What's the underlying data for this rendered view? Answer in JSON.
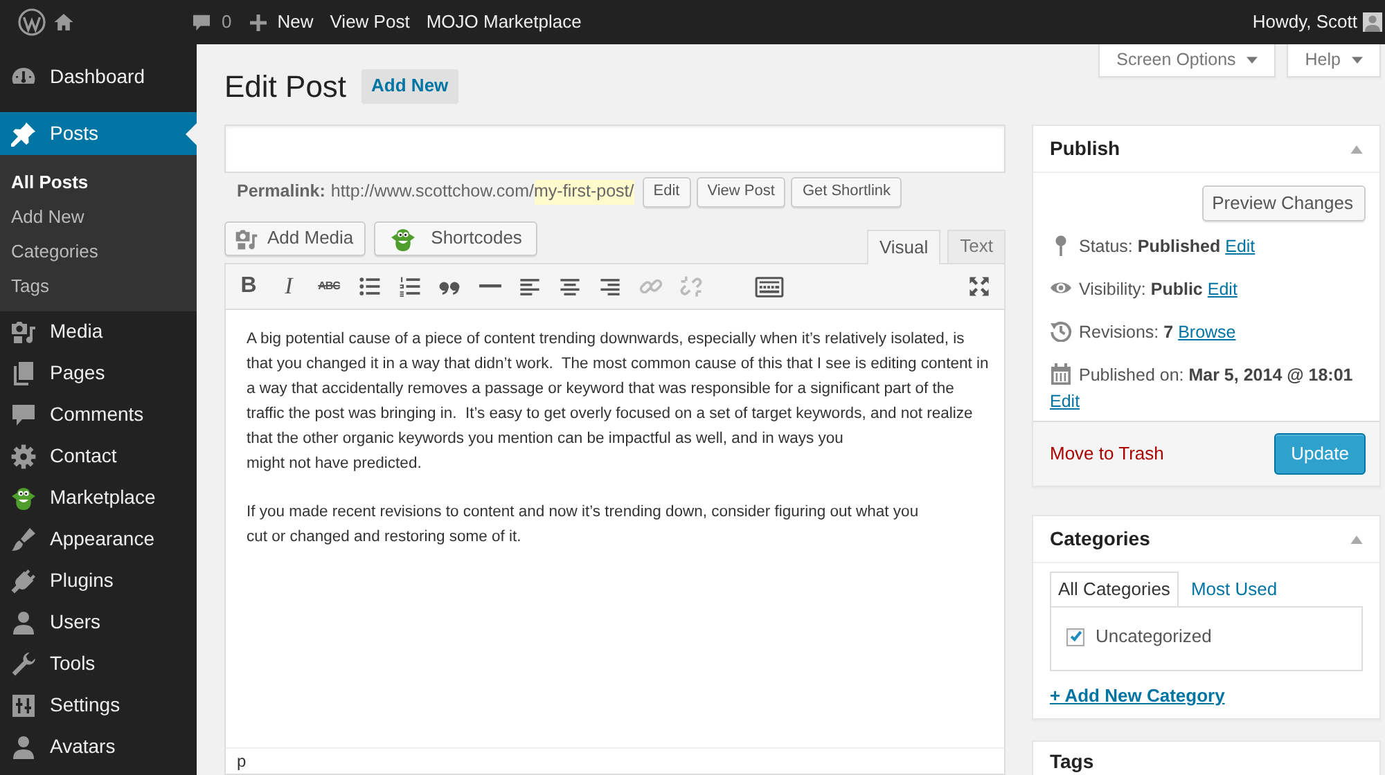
{
  "admin_bar": {
    "items": [
      {
        "kind": "comments",
        "label": "0"
      },
      {
        "kind": "new",
        "label": "New"
      },
      {
        "kind": "link",
        "label": "View Post"
      },
      {
        "kind": "link",
        "label": "MOJO Marketplace"
      }
    ],
    "greeting": "Howdy, Scott"
  },
  "sidebar": {
    "items": [
      {
        "label": "Dashboard",
        "selected": false
      },
      {
        "label": "Posts",
        "selected": true,
        "children": [
          {
            "label": "All Posts",
            "selected": true
          },
          {
            "label": "Add New",
            "selected": false
          },
          {
            "label": "Categories",
            "selected": false
          },
          {
            "label": "Tags",
            "selected": false
          }
        ]
      },
      {
        "label": "Media",
        "selected": false
      },
      {
        "label": "Pages",
        "selected": false
      },
      {
        "label": "Comments",
        "selected": false
      },
      {
        "label": "Contact",
        "selected": false
      },
      {
        "label": "Marketplace",
        "selected": false
      },
      {
        "label": "Appearance",
        "selected": false
      },
      {
        "label": "Plugins",
        "selected": false
      },
      {
        "label": "Users",
        "selected": false
      },
      {
        "label": "Tools",
        "selected": false
      },
      {
        "label": "Settings",
        "selected": false
      },
      {
        "label": "Avatars",
        "selected": false
      }
    ]
  },
  "screen_meta": {
    "tabs": [
      "Screen Options",
      "Help"
    ]
  },
  "page": {
    "title": "Edit Post",
    "add_new": "Add New"
  },
  "permalink": {
    "label": "Permalink:",
    "base": "http://www.scottchow.com/",
    "slug": "my-first-post/",
    "buttons": [
      "Edit",
      "View Post",
      "Get Shortlink"
    ]
  },
  "media_buttons": [
    {
      "kind": "media",
      "label": "Add Media"
    },
    {
      "kind": "shortcodes",
      "label": "Shortcodes"
    }
  ],
  "editor_tabs": [
    {
      "label": "Visual",
      "selected": true
    },
    {
      "label": "Text",
      "selected": false
    }
  ],
  "toolbar": [
    {
      "kind": "bold",
      "glyph": "B",
      "disabled": false
    },
    {
      "kind": "italic",
      "glyph": "I",
      "disabled": false
    },
    {
      "kind": "strikethrough",
      "glyph": "ABC",
      "disabled": false
    },
    {
      "kind": "bullet-list",
      "disabled": false
    },
    {
      "kind": "numbered-list",
      "disabled": false
    },
    {
      "kind": "blockquote",
      "disabled": false
    },
    {
      "kind": "horizontal-rule",
      "disabled": false
    },
    {
      "kind": "align-left",
      "disabled": false
    },
    {
      "kind": "align-center",
      "disabled": false
    },
    {
      "kind": "align-right",
      "disabled": false
    },
    {
      "kind": "link",
      "disabled": true
    },
    {
      "kind": "unlink",
      "disabled": true
    },
    {
      "kind": "toolbar-toggle",
      "disabled": false
    },
    {
      "kind": "fullscreen",
      "disabled": false
    }
  ],
  "editor": {
    "paragraphs": [
      "A big potential cause of a piece of content trending downwards, especially when it’s relatively isolated, is that you changed it in a way that didn’t work.  The most common cause of this that I see is editing content in a way that accidentally removes a passage or keyword that was responsible for a significant part of the traffic the post was bringing in.  It’s easy to get overly focused on a set of target keywords, and not realize that the other organic keywords you mention can be impactful as well, and in ways you\nmight not have predicted.",
      "If you made recent revisions to content and now it’s trending down, consider figuring out what you\ncut or changed and restoring some of it."
    ],
    "path": "p"
  },
  "publish": {
    "title": "Publish",
    "preview": "Preview Changes",
    "rows": [
      {
        "kind": "status",
        "text": "Status: **Published**",
        "link": "Edit"
      },
      {
        "kind": "visibility",
        "text": "Visibility: **Public**",
        "link": "Edit"
      },
      {
        "kind": "revisions",
        "text": "Revisions: **7**",
        "link": "Browse"
      },
      {
        "kind": "schedule",
        "text": "Published on: **Mar 5, 2014 @ 18:01**",
        "link": "Edit"
      }
    ],
    "trash": "Move to Trash",
    "update": "Update"
  },
  "categories": {
    "title": "Categories",
    "tabs": [
      {
        "label": "All Categories",
        "selected": true
      },
      {
        "label": "Most Used",
        "selected": false
      }
    ],
    "items": [
      {
        "label": "Uncategorized",
        "checked": true
      }
    ],
    "add_link": "+ Add New Category"
  },
  "tags": {
    "title": "Tags"
  }
}
